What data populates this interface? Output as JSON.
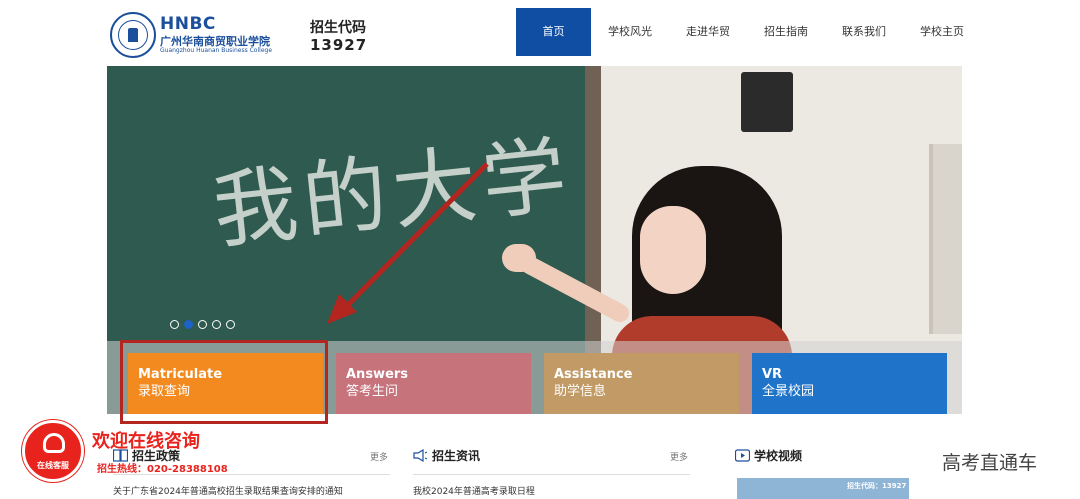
{
  "header": {
    "brand_abbr": "HNBC",
    "brand_cn": "广州华南商贸职业学院",
    "brand_en": "Guangzhou Huanan Business College",
    "code_label": "招生代码",
    "code_value": "13927"
  },
  "nav": {
    "items": [
      {
        "label": "首页",
        "active": true
      },
      {
        "label": "学校风光"
      },
      {
        "label": "走进华贸"
      },
      {
        "label": "招生指南"
      },
      {
        "label": "联系我们"
      },
      {
        "label": "学校主页"
      }
    ]
  },
  "banner": {
    "chalk_text": "我的大学",
    "slides_total": 5,
    "active_slide": 2
  },
  "tiles": [
    {
      "en": "Matriculate",
      "cn": "录取查询",
      "color": "#f28a1f"
    },
    {
      "en": "Answers",
      "cn": "答考生问",
      "color": "#c7737c"
    },
    {
      "en": "Assistance",
      "cn": "助学信息",
      "color": "#c19a66"
    },
    {
      "en": "VR",
      "cn": "全景校园",
      "color": "#1f74c9"
    }
  ],
  "sections": {
    "policy": {
      "title": "招生政策",
      "more": "更多",
      "first_item": "关于广东省2024年普通高校招生录取结果查询安排的通知"
    },
    "news": {
      "title": "招生资讯",
      "more": "更多",
      "first_item": "我校2024年普通高考录取日程"
    },
    "video": {
      "title": "学校视频",
      "thumb_text": "招生代码：13927"
    }
  },
  "chat": {
    "button_label": "在线客服",
    "title": "欢迎在线咨询",
    "phone": "招生热线：020-28388108"
  },
  "watermark": "高考直通车",
  "colors": {
    "brand": "#1b4f9c",
    "nav_active": "#0f4ea3",
    "annotation": "#b3261f",
    "chat": "#e8231d"
  }
}
